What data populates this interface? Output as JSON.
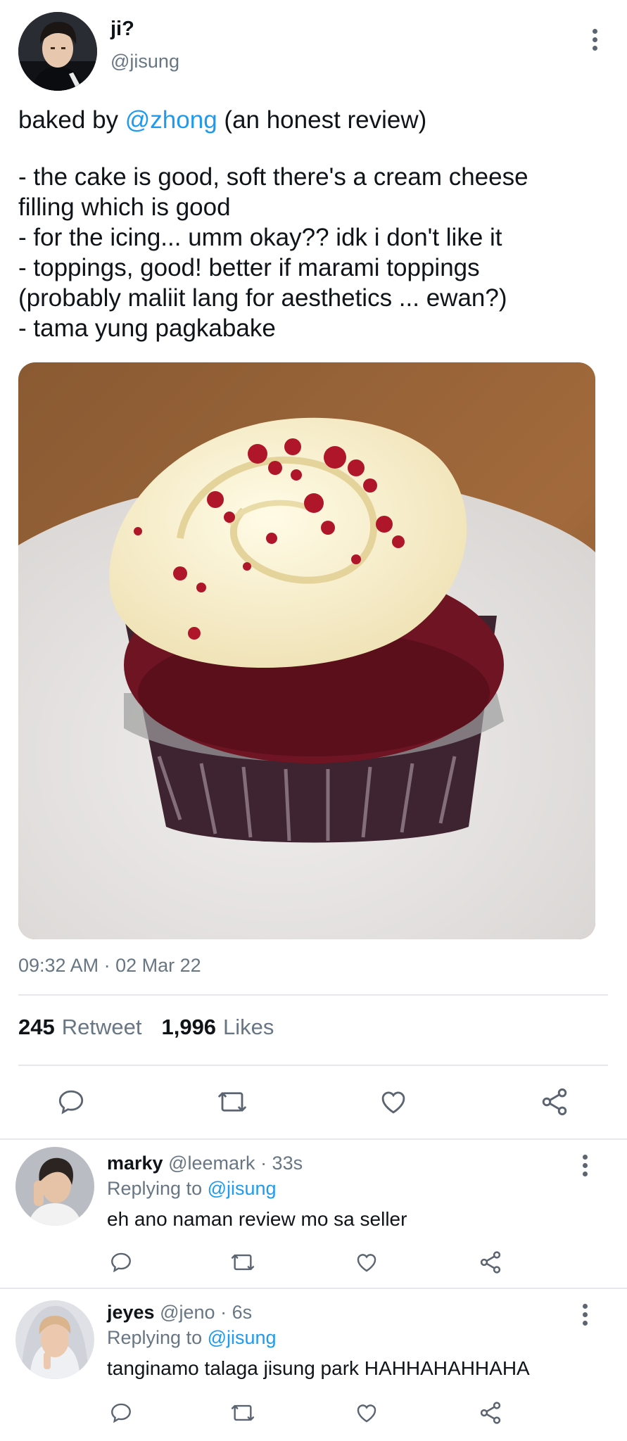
{
  "tweet": {
    "author_name": "ji?",
    "author_handle": "@jisung",
    "text_prefix": "baked by ",
    "mention": "@zhong",
    "text_suffix": " (an honest review)",
    "lines": [
      "- the cake is good, soft there's a cream cheese",
      "filling which is good",
      "- for the icing... umm okay?? idk i don't like it",
      "- toppings, good! better if marami toppings",
      "(probably maliit lang for aesthetics ... ewan?)",
      "- tama yung pagkabake"
    ],
    "timestamp": "09:32 AM · 02 Mar 22",
    "retweet_count": "245",
    "retweet_label": "Retweet",
    "likes_count": "1,996",
    "likes_label": "Likes"
  },
  "actions": [
    "reply-icon",
    "retweet-icon",
    "like-icon",
    "share-icon"
  ],
  "replies": [
    {
      "name": "marky",
      "handle": "@leemark",
      "time": "· 33s",
      "replying_label": "Replying to ",
      "replying_to": "@jisung",
      "text": "eh ano naman review mo sa seller"
    },
    {
      "name": "jeyes",
      "handle": "@jeno",
      "time": "· 6s",
      "replying_label": "Replying to ",
      "replying_to": "@jisung",
      "text": "tanginamo talaga jisung park HAHHAHAHHAHA"
    }
  ],
  "colors": {
    "accent": "#1d9bf0",
    "secondary_text": "#687684",
    "divider": "#e6e9eb"
  }
}
